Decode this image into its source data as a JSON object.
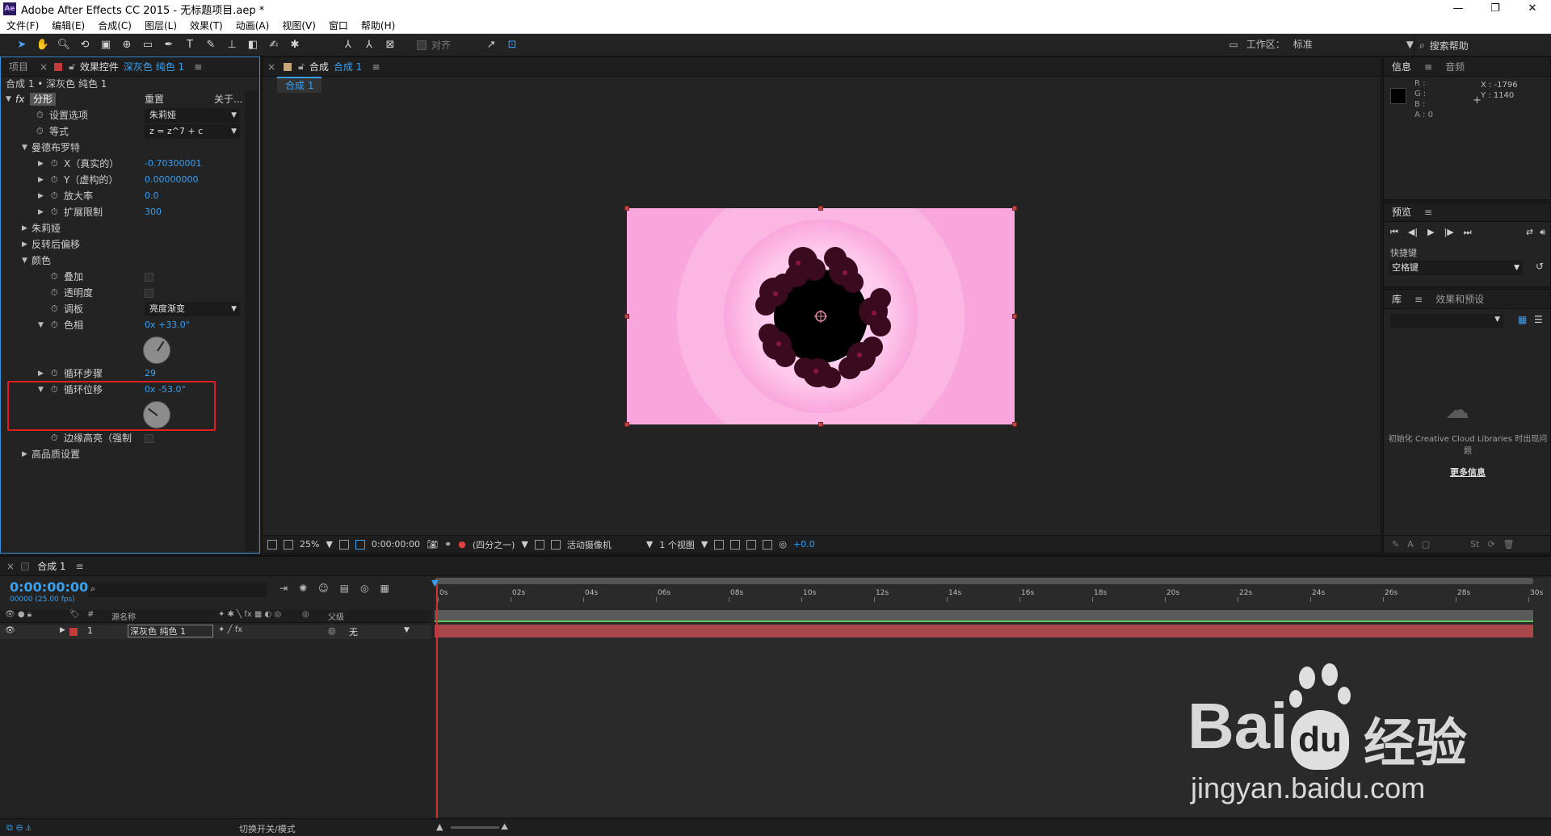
{
  "window": {
    "title": "Adobe After Effects CC 2015 - 无标题项目.aep *",
    "logo": "Ae",
    "controls": [
      "—",
      "❐",
      "✕"
    ]
  },
  "menu": [
    "文件(F)",
    "编辑(E)",
    "合成(C)",
    "图层(L)",
    "效果(T)",
    "动画(A)",
    "视图(V)",
    "窗口",
    "帮助(H)"
  ],
  "toolbar": {
    "snap_label": "对齐",
    "workspace_label": "工作区：",
    "workspace_value": "标准",
    "search_help": "搜索帮助"
  },
  "project_tab": "项目",
  "effects": {
    "tab_label": "效果控件",
    "tab_target": "深灰色 纯色 1",
    "breadcrumb": "合成 1 • 深灰色 纯色 1",
    "fx_name": "分形",
    "reset": "重置",
    "about": "关于...",
    "rows": {
      "set_choice": {
        "label": "设置选项",
        "value": "朱莉娅"
      },
      "equation": {
        "label": "等式",
        "value": "z = z^7 + c"
      },
      "mandelbrot": {
        "label": "曼德布罗特"
      },
      "x_real": {
        "label": "X（真实的）",
        "value": "-0.70300001"
      },
      "y_imag": {
        "label": "Y（虚构的）",
        "value": "0.00000000"
      },
      "magnification": {
        "label": "放大率",
        "value": "0.0"
      },
      "escape_limit": {
        "label": "扩展限制",
        "value": "300"
      },
      "julia": {
        "label": "朱莉娅"
      },
      "post_invert_offset": {
        "label": "反转后偏移"
      },
      "color": {
        "label": "颜色"
      },
      "overlay": {
        "label": "叠加"
      },
      "transparency": {
        "label": "透明度"
      },
      "palette": {
        "label": "调板",
        "value": "亮度渐变"
      },
      "hue": {
        "label": "色相",
        "value": "0x +33.0°",
        "angle_deg": 33
      },
      "cycle_steps": {
        "label": "循环步骤",
        "value": "29"
      },
      "cycle_offset": {
        "label": "循环位移",
        "value": "0x -53.0°",
        "angle_deg": -53
      },
      "edge_highlight": {
        "label": "边缘高亮（强制"
      },
      "high_quality": {
        "label": "高品质设置"
      }
    }
  },
  "composition": {
    "tab_label": "合成",
    "tab_name": "合成 1",
    "sub_tab": "合成 1",
    "footer": {
      "zoom": "25%",
      "timecode": "0:00:00:00",
      "resolution": "(四分之一)",
      "camera": "活动摄像机",
      "views": "1 个视图",
      "exposure": "+0.0"
    }
  },
  "info_panel": {
    "tabs": [
      "信息",
      "音频"
    ],
    "rgba": [
      "R :",
      "G :",
      "B :",
      "A : 0"
    ],
    "x": "X : -1796",
    "y": "Y : 1140"
  },
  "preview_panel": {
    "tab": "预览",
    "shortcut_label": "快捷键",
    "shortcut_value": "空格键"
  },
  "library_panel": {
    "tabs": [
      "库",
      "效果和预设"
    ],
    "message": "初始化 Creative Cloud Libraries 时出现问题",
    "more_info": "更多信息"
  },
  "timeline": {
    "tab": "合成 1",
    "timecode": "0:00:00:00",
    "frames": "00000 (25.00 fps)",
    "col_source": "源名称",
    "col_parent": "父级",
    "col_hash": "#",
    "ruler": [
      "0s",
      "02s",
      "04s",
      "06s",
      "08s",
      "10s",
      "12s",
      "14s",
      "16s",
      "18s",
      "20s",
      "22s",
      "24s",
      "26s",
      "28s",
      "30s"
    ],
    "layer": {
      "index": "1",
      "name": "深灰色 纯色 1",
      "parent": "无",
      "color": "#c23a3a"
    },
    "bottom_label": "切换开关/模式"
  },
  "watermark": {
    "brand_left": "Bai",
    "brand_right": "du",
    "brand_cn": "经验",
    "url": "jingyan.baidu.com"
  },
  "colors": {
    "accent": "#3aa0f0",
    "comp_bg": "#f9a6dc",
    "layer_bar": "#a8464a",
    "highlight_box": "#e02020"
  }
}
